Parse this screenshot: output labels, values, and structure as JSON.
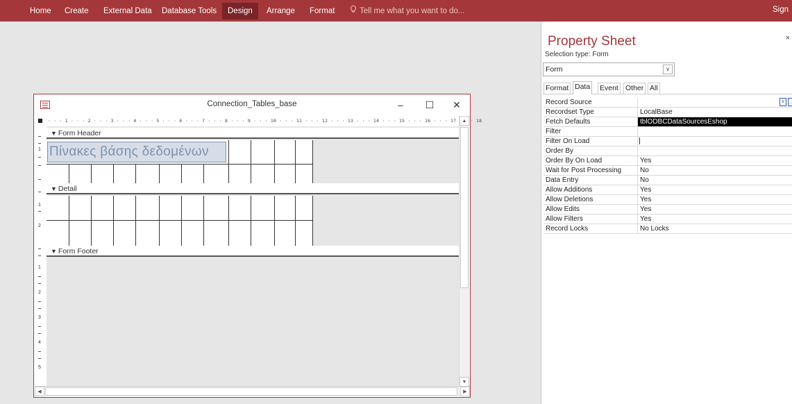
{
  "ribbon": {
    "tabs": [
      {
        "label": "Home",
        "selected": false
      },
      {
        "label": "Create",
        "selected": false
      },
      {
        "label": "External Data",
        "selected": false
      },
      {
        "label": "Database Tools",
        "selected": false
      },
      {
        "label": "Design",
        "selected": true
      },
      {
        "label": "Arrange",
        "selected": false
      },
      {
        "label": "Format",
        "selected": false
      }
    ],
    "tell_me": "Tell me what you want to do...",
    "sign_in": "Sign",
    "accent_color": "#a4373a"
  },
  "form_window": {
    "title": "Connection_Tables_base",
    "minimize_glyph": "‒",
    "maximize_glyph": "☐",
    "close_glyph": "✕",
    "ruler_marks": "· · · 1 · · · 2 · · · 3 · · · 4 · · · 5 · · · 6 · · · 7 · · · 8 · · · 9 · · · 10 · · · 11 · · · 12 · · · 13 · · · 14 · · · 15 · · · 16 · · · 17 · · · 18",
    "vruler_numbers": [
      "1",
      "1",
      "2",
      "1",
      "2",
      "3",
      "4",
      "5"
    ],
    "sections": {
      "header": "Form Header",
      "detail": "Detail",
      "footer": "Form Footer"
    },
    "header_label": "Πίνακες βάσης δεδομένων",
    "section_marker": "❮"
  },
  "property_sheet": {
    "title": "Property Sheet",
    "selection_type": "Selection type:  Form",
    "combo_value": "Form",
    "tabs": [
      {
        "label": "Format",
        "active": false
      },
      {
        "label": "Data",
        "active": true
      },
      {
        "label": "Event",
        "active": false
      },
      {
        "label": "Other",
        "active": false
      },
      {
        "label": "All",
        "active": false
      }
    ],
    "rows": [
      {
        "name": "Record Source",
        "value": ""
      },
      {
        "name": "Recordset Type",
        "value": "LocalBase"
      },
      {
        "name": "Fetch Defaults",
        "value": "tblODBCDataSourcesEshop"
      },
      {
        "name": "Filter",
        "value": ""
      },
      {
        "name": "Filter On Load",
        "value": ""
      },
      {
        "name": "Order By",
        "value": ""
      },
      {
        "name": "Order By On Load",
        "value": "Yes"
      },
      {
        "name": "Wait for Post Processing",
        "value": "No"
      },
      {
        "name": "Data Entry",
        "value": "No"
      },
      {
        "name": "Allow Additions",
        "value": "Yes"
      },
      {
        "name": "Allow Deletions",
        "value": "Yes"
      },
      {
        "name": "Allow Edits",
        "value": "Yes"
      },
      {
        "name": "Allow Filters",
        "value": "Yes"
      },
      {
        "name": "Record Locks",
        "value": "No Locks"
      }
    ]
  }
}
